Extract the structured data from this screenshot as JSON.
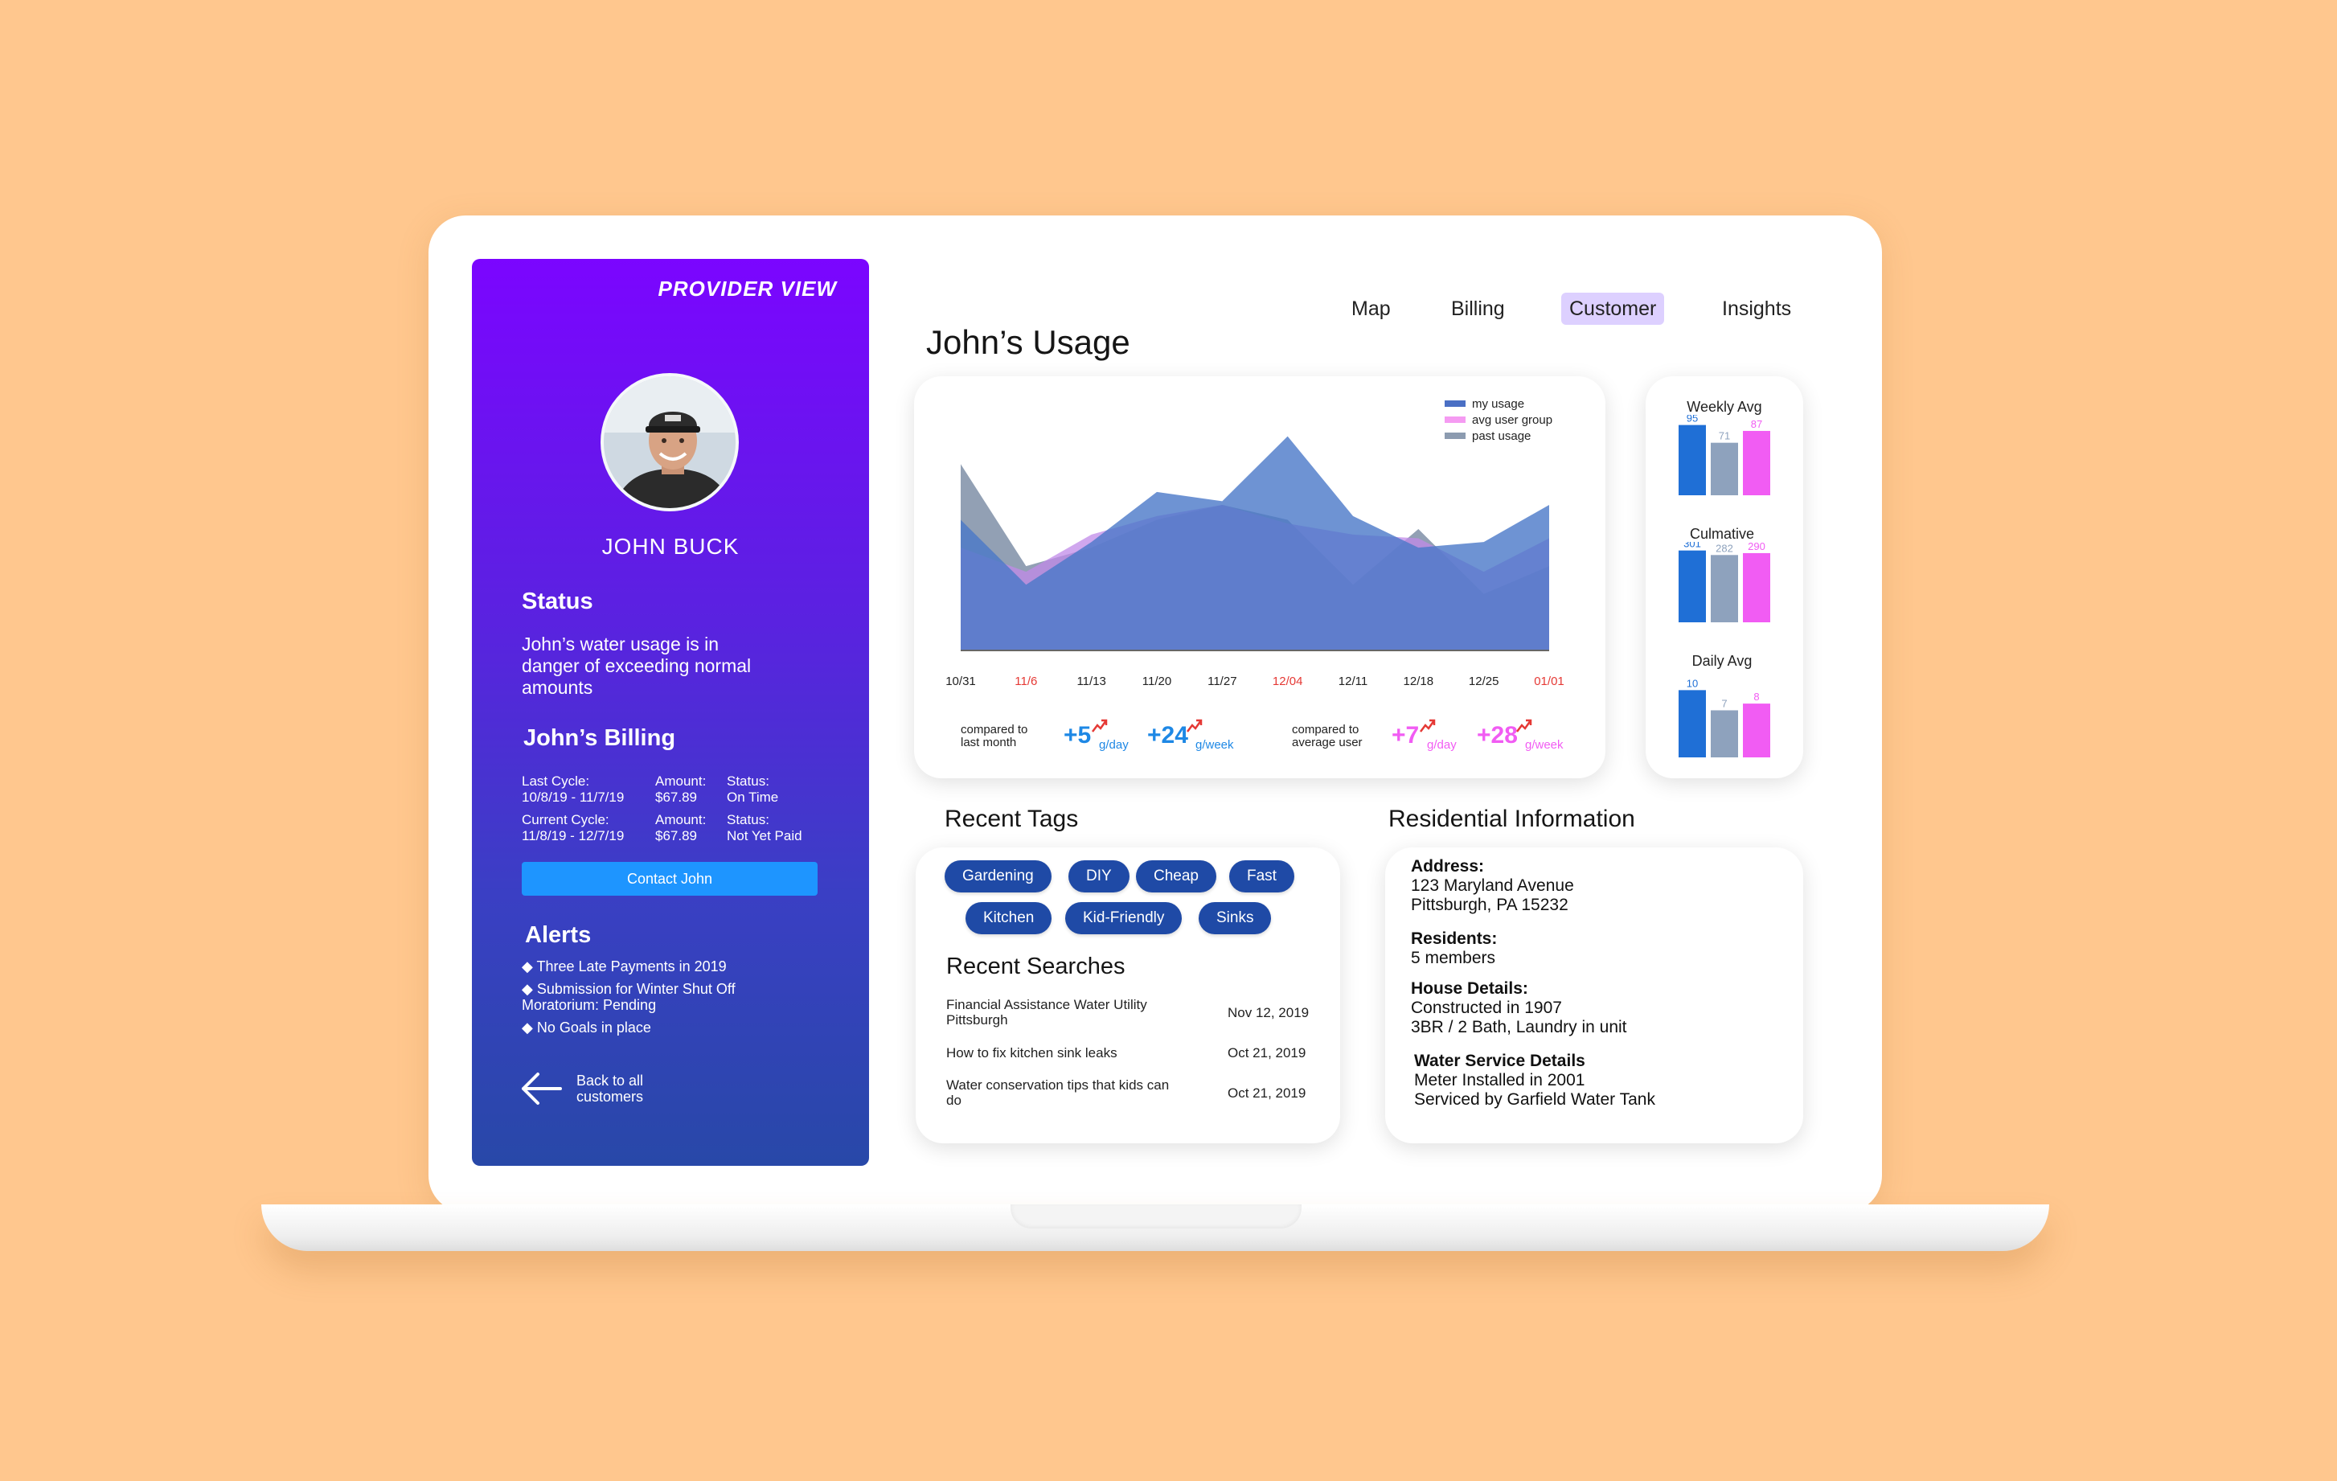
{
  "sidebar": {
    "badge": "PROVIDER VIEW",
    "customer_name": "JOHN BUCK",
    "status_heading": "Status",
    "status_text": "John’s water usage is in danger of exceeding normal amounts",
    "billing_heading": "John’s Billing",
    "billing": {
      "last_cycle_label": "Last Cycle:",
      "last_cycle_dates": "10/8/19 - 11/7/19",
      "last_amount_label": "Amount:",
      "last_amount": "$67.89",
      "last_status_label": "Status:",
      "last_status": "On Time",
      "current_cycle_label": "Current Cycle:",
      "current_cycle_dates": "11/8/19 - 12/7/19",
      "current_amount_label": "Amount:",
      "current_amount": "$67.89",
      "current_status_label": "Status:",
      "current_status": "Not Yet Paid"
    },
    "contact_button": "Contact John",
    "alerts_heading": "Alerts",
    "alerts": [
      "◆ Three Late Payments in 2019",
      "◆ Submission for Winter Shut Off Moratorium: Pending",
      "◆ No Goals in place"
    ],
    "back_label": "Back to all customers"
  },
  "nav": {
    "items": [
      "Map",
      "Billing",
      "Customer",
      "Insights"
    ],
    "active": "Customer"
  },
  "usage": {
    "title": "John’s Usage",
    "compare_month_label": "compared to last month",
    "month_day": "+5",
    "month_day_unit": "g/day",
    "month_week": "+24",
    "month_week_unit": "g/week",
    "compare_avg_label": "compared to average user",
    "avg_day": "+7",
    "avg_day_unit": "g/day",
    "avg_week": "+28",
    "avg_week_unit": "g/week"
  },
  "chart_data": [
    {
      "type": "area",
      "x": [
        "10/31",
        "11/6",
        "11/13",
        "11/20",
        "11/27",
        "12/04",
        "12/11",
        "12/18",
        "12/25",
        "01/01"
      ],
      "x_highlight": [
        "11/6",
        "12/04",
        "01/01"
      ],
      "series": [
        {
          "name": "past usage",
          "values": [
            100,
            45,
            55,
            70,
            78,
            70,
            35,
            65,
            30,
            45
          ],
          "color": "#8c9bb0"
        },
        {
          "name": "avg user group",
          "values": [
            55,
            42,
            62,
            72,
            78,
            68,
            62,
            60,
            42,
            60
          ],
          "color": "#c08ae8"
        },
        {
          "name": "my usage",
          "values": [
            70,
            35,
            58,
            85,
            80,
            115,
            72,
            55,
            58,
            78
          ],
          "color": "#4a78c8"
        }
      ],
      "ylim": [
        0,
        130
      ],
      "legend": "top-right"
    },
    {
      "type": "bar",
      "title": "Weekly Avg",
      "values": [
        95,
        71,
        87
      ],
      "colors": [
        "#1f6fd6",
        "#8ea2bd",
        "#f15cf3"
      ],
      "ylim": [
        0,
        100
      ]
    },
    {
      "type": "bar",
      "title": "Culmative",
      "values": [
        301,
        282,
        290
      ],
      "colors": [
        "#1f6fd6",
        "#8ea2bd",
        "#f15cf3"
      ],
      "ylim": [
        0,
        310
      ]
    },
    {
      "type": "bar",
      "title": "Daily Avg",
      "values": [
        10,
        7,
        8
      ],
      "colors": [
        "#1f6fd6",
        "#8ea2bd",
        "#f15cf3"
      ],
      "ylim": [
        0,
        11
      ]
    }
  ],
  "tags": {
    "heading": "Recent Tags",
    "items": [
      "Gardening",
      "DIY",
      "Cheap",
      "Fast",
      "Kitchen",
      "Kid-Friendly",
      "Sinks"
    ]
  },
  "searches": {
    "heading": "Recent Searches",
    "rows": [
      {
        "query": "Financial Assistance Water Utility Pittsburgh",
        "date": "Nov 12, 2019"
      },
      {
        "query": "How to fix kitchen sink leaks",
        "date": "Oct 21, 2019"
      },
      {
        "query": "Water conservation tips that kids can do",
        "date": "Oct 21, 2019"
      }
    ]
  },
  "residential": {
    "heading": "Residential Information",
    "address_label": "Address:",
    "address_1": "123 Maryland Avenue",
    "address_2": "Pittsburgh, PA 15232",
    "residents_label": "Residents:",
    "residents": "5 members",
    "house_label": "House Details:",
    "house_1": "Constructed in 1907",
    "house_2": "3BR / 2 Bath, Laundry in unit",
    "water_label": "Water Service Details",
    "water_1": "Meter Installed in 2001",
    "water_2": "Serviced by Garfield Water Tank"
  },
  "colors": {
    "background": "#ffc78e",
    "sidebar_top": "#7b05ff",
    "sidebar_bottom": "#2848a8",
    "accent_blue": "#1e95ff",
    "tag": "#1f4aa6",
    "nav_active": "#ddd0ff",
    "blue_metric": "#1e88e5",
    "pink_metric": "#f15cf3",
    "highlight_red": "#e53935"
  }
}
